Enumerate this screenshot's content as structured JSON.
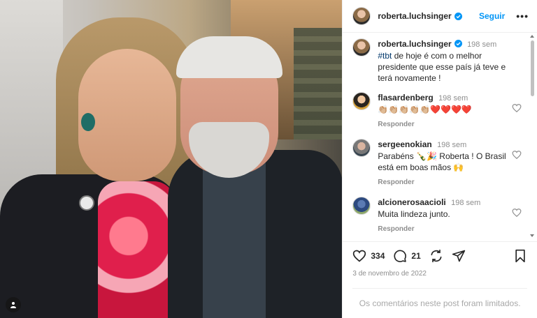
{
  "post": {
    "username": "roberta.luchsinger",
    "follow_label": "Seguir",
    "more_label": "•••",
    "caption": {
      "time": "198 sem",
      "hashtag": "#tbt",
      "text": " de hoje é com o melhor presidente que esse país já teve e terá novamente !"
    },
    "comments": [
      {
        "username": "flasardenberg",
        "time": "198 sem",
        "text": "👏🏼👏🏼👏🏼👏🏼👏🏼❤️❤️❤️❤️",
        "reply_label": "Responder"
      },
      {
        "username": "sergeenokian",
        "time": "198 sem",
        "text": "Parabéns 🍾🎉 Roberta ! O Brasil está em boas mãos 🙌",
        "reply_label": "Responder"
      },
      {
        "username": "alcionerosaacioli",
        "time": "198 sem",
        "text": "Muita lindeza junto.",
        "reply_label": "Responder"
      }
    ],
    "likes": "334",
    "comments_count": "21",
    "date": "3 de novembro de 2022",
    "comments_limited": "Os comentários neste post foram limitados."
  },
  "colors": {
    "accent": "#0095f6",
    "text": "#262626",
    "muted": "#8e8e8e"
  },
  "icons": [
    "verified-badge-icon",
    "more-options-icon",
    "heart-icon",
    "comment-icon",
    "share-icon",
    "send-icon",
    "bookmark-icon",
    "user-tag-icon"
  ]
}
